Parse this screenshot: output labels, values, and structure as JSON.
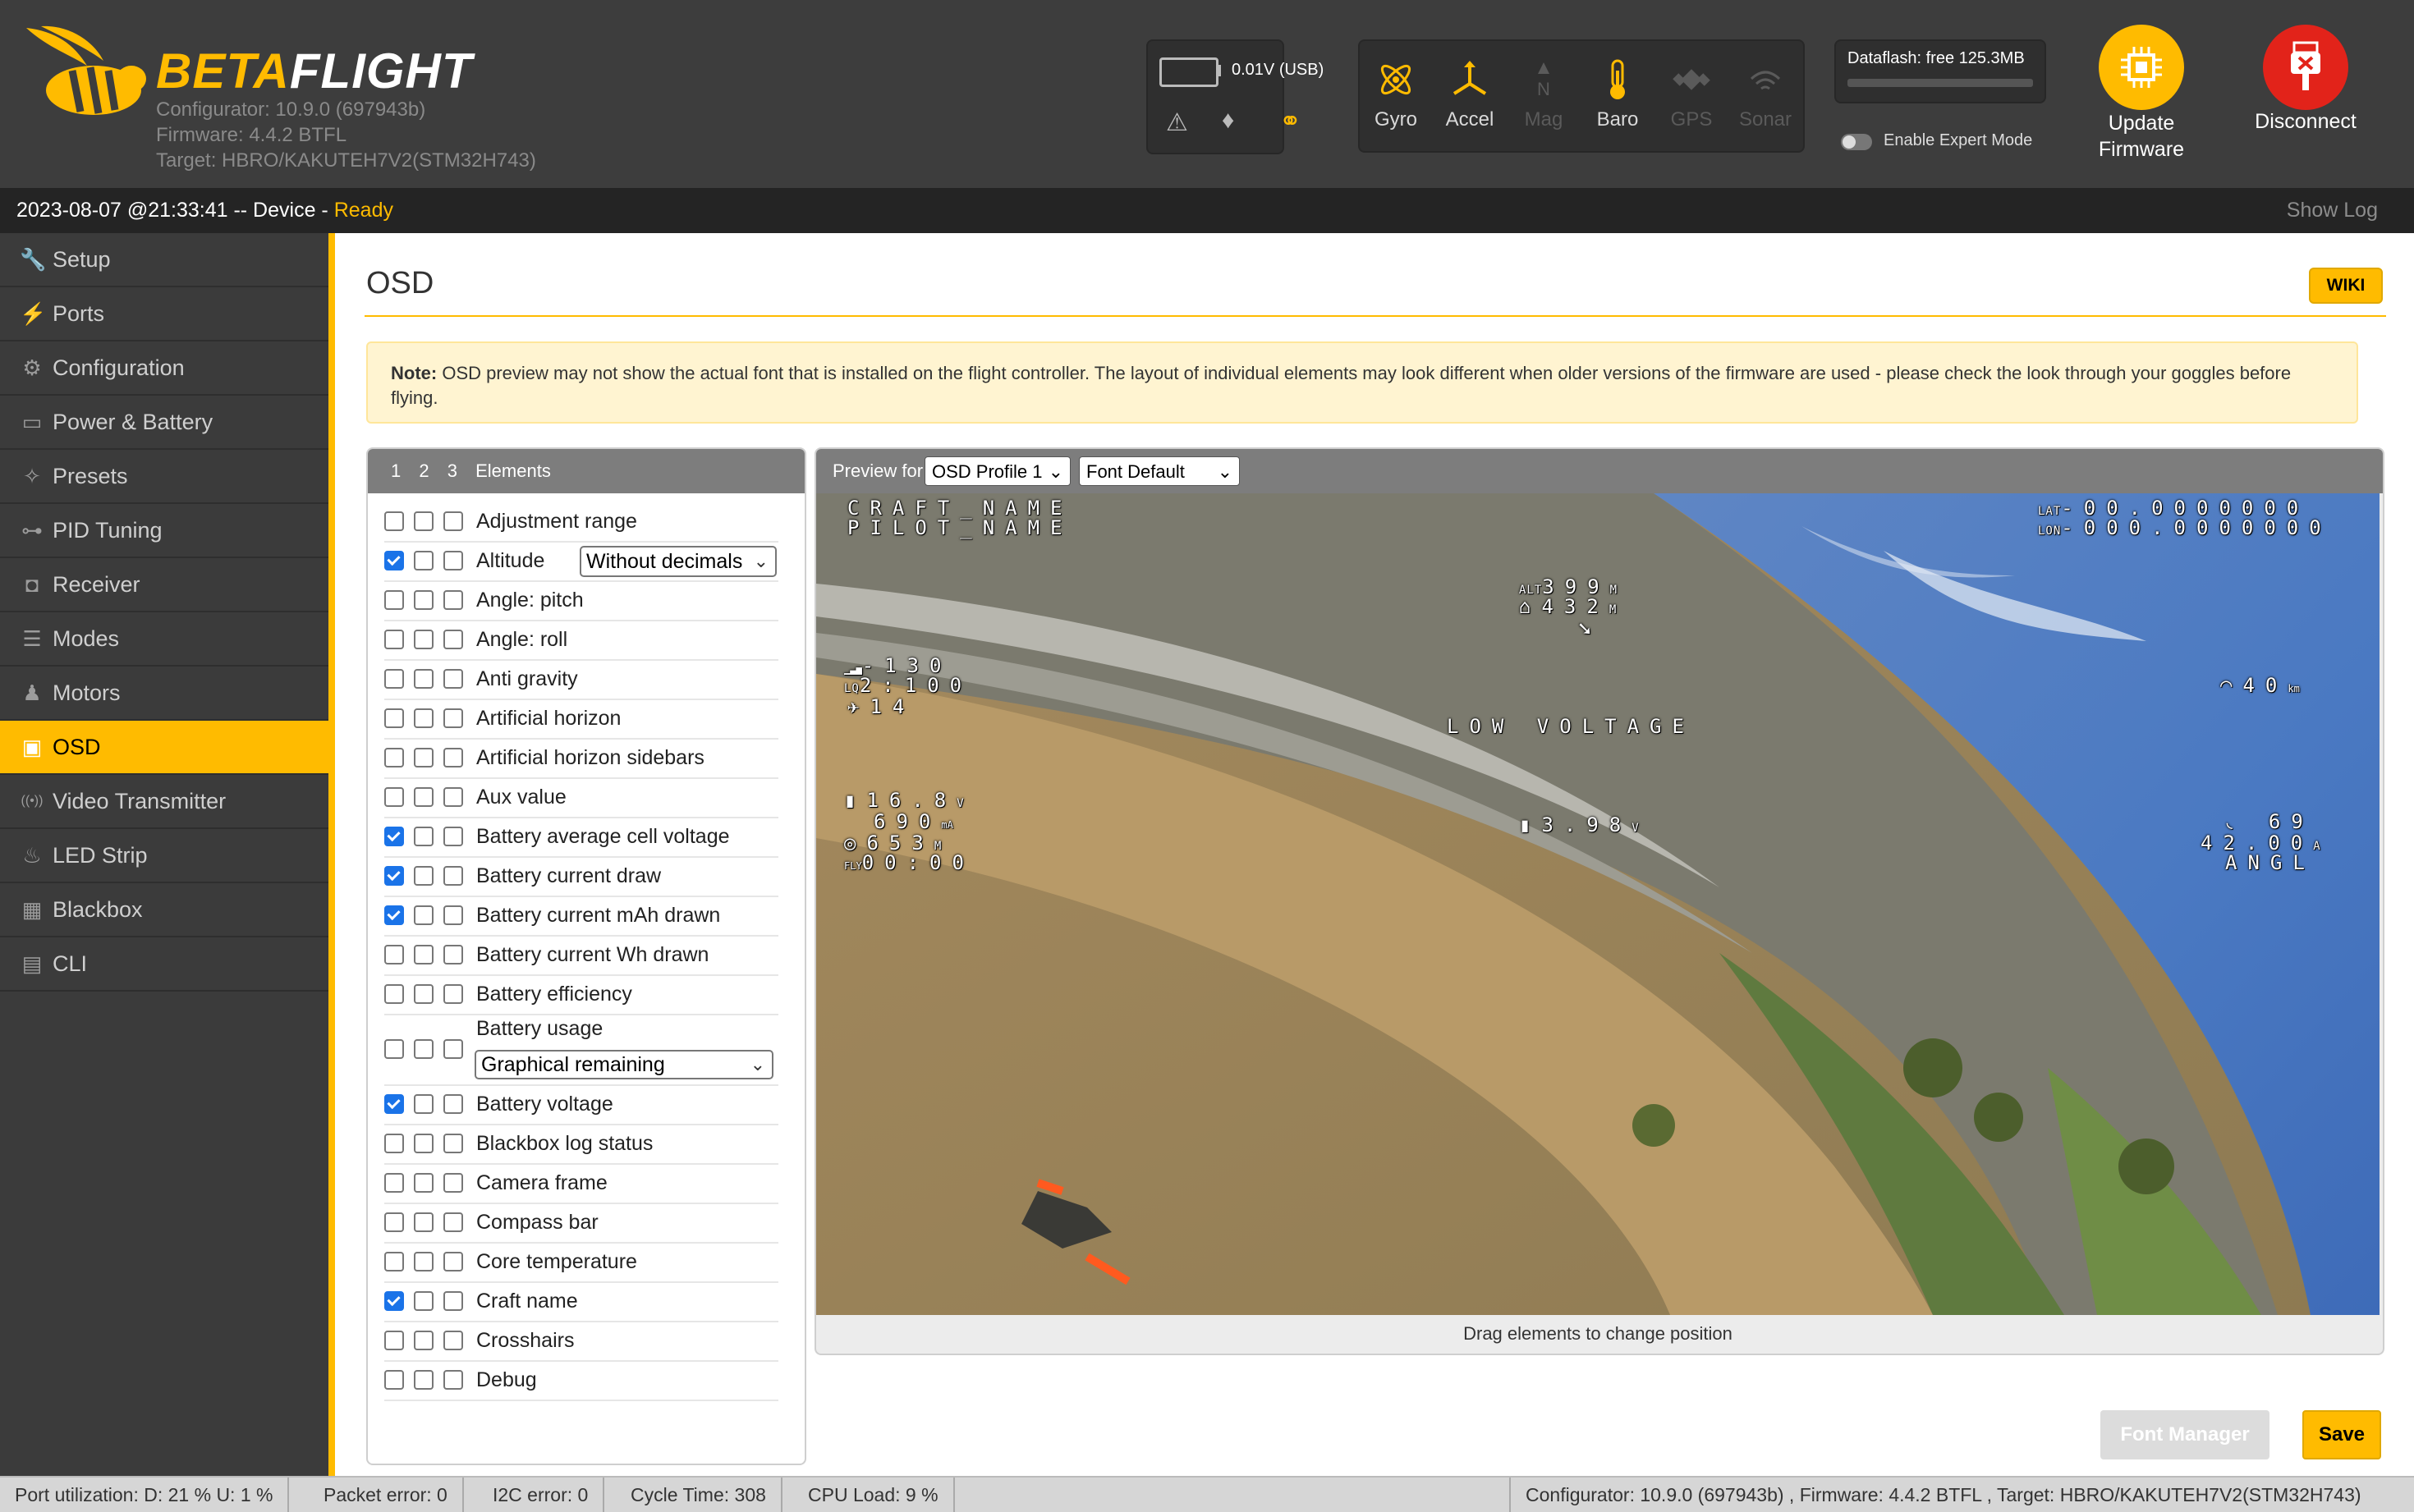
{
  "header": {
    "brand_left": "BETA",
    "brand_right": "FLIGHT",
    "configurator": "Configurator: 10.9.0 (697943b)",
    "firmware": "Firmware: 4.4.2 BTFL",
    "target": "Target: HBRO/KAKUTEH7V2(STM32H743)",
    "battery": "0.01V (USB)",
    "sensors": [
      {
        "label": "Gyro",
        "active": true,
        "icon": "gyro-icon"
      },
      {
        "label": "Accel",
        "active": true,
        "icon": "accel-icon"
      },
      {
        "label": "Mag",
        "active": false,
        "icon": "mag-icon"
      },
      {
        "label": "Baro",
        "active": true,
        "icon": "baro-icon"
      },
      {
        "label": "GPS",
        "active": false,
        "icon": "gps-icon"
      },
      {
        "label": "Sonar",
        "active": false,
        "icon": "sonar-icon"
      }
    ],
    "dataflash": "Dataflash: free 125.3MB",
    "expert_mode": "Enable Expert Mode",
    "update_firmware_1": "Update",
    "update_firmware_2": "Firmware",
    "disconnect": "Disconnect"
  },
  "status": {
    "datetime": "2023-08-07 @21:33:41 -- Device - ",
    "state": "Ready",
    "show_log": "Show Log"
  },
  "sidebar": {
    "items": [
      {
        "label": "Setup",
        "icon": "wrench-icon",
        "glyph": "🔧",
        "active": false
      },
      {
        "label": "Ports",
        "icon": "plug-icon",
        "glyph": "⚡",
        "active": false
      },
      {
        "label": "Configuration",
        "icon": "gear-icon",
        "glyph": "⚙",
        "active": false
      },
      {
        "label": "Power & Battery",
        "icon": "battery-icon",
        "glyph": "▭",
        "active": false
      },
      {
        "label": "Presets",
        "icon": "wand-icon",
        "glyph": "✧",
        "active": false
      },
      {
        "label": "PID Tuning",
        "icon": "sitemap-icon",
        "glyph": "⊶",
        "active": false
      },
      {
        "label": "Receiver",
        "icon": "robot-icon",
        "glyph": "◘",
        "active": false
      },
      {
        "label": "Modes",
        "icon": "toggle-icon",
        "glyph": "☰",
        "active": false
      },
      {
        "label": "Motors",
        "icon": "motor-icon",
        "glyph": "♟",
        "active": false
      },
      {
        "label": "OSD",
        "icon": "osd-icon",
        "glyph": "▣",
        "active": true
      },
      {
        "label": "Video Transmitter",
        "icon": "broadcast-icon",
        "glyph": "((•))",
        "active": false
      },
      {
        "label": "LED Strip",
        "icon": "led-icon",
        "glyph": "♨",
        "active": false
      },
      {
        "label": "Blackbox",
        "icon": "chip-icon",
        "glyph": "▦",
        "active": false
      },
      {
        "label": "CLI",
        "icon": "terminal-icon",
        "glyph": "▤",
        "active": false
      }
    ]
  },
  "main": {
    "title": "OSD",
    "wiki": "WIKI",
    "note_bold": "Note:",
    "note_text": " OSD preview may not show the actual font that is installed on the flight controller. The layout of individual elements may look different when older versions of the firmware are used - please check the look through your goggles before flying.",
    "elements_tabs": [
      "1",
      "2",
      "3"
    ],
    "elements_title": "Elements",
    "rows": [
      {
        "label": "Adjustment range",
        "c1": false
      },
      {
        "label": "Altitude",
        "c1": true,
        "select": "Without decimals"
      },
      {
        "label": "Angle: pitch",
        "c1": false
      },
      {
        "label": "Angle: roll",
        "c1": false
      },
      {
        "label": "Anti gravity",
        "c1": false
      },
      {
        "label": "Artificial horizon",
        "c1": false
      },
      {
        "label": "Artificial horizon sidebars",
        "c1": false
      },
      {
        "label": "Aux value",
        "c1": false
      },
      {
        "label": "Battery average cell voltage",
        "c1": true
      },
      {
        "label": "Battery current draw",
        "c1": true
      },
      {
        "label": "Battery current mAh drawn",
        "c1": true
      },
      {
        "label": "Battery current Wh drawn",
        "c1": false
      },
      {
        "label": "Battery efficiency",
        "c1": false
      },
      {
        "label": "Battery usage",
        "c1": false,
        "select": "Graphical remaining"
      },
      {
        "label": "Battery voltage",
        "c1": true
      },
      {
        "label": "Blackbox log status",
        "c1": false
      },
      {
        "label": "Camera frame",
        "c1": false
      },
      {
        "label": "Compass bar",
        "c1": false
      },
      {
        "label": "Core temperature",
        "c1": false
      },
      {
        "label": "Craft name",
        "c1": true
      },
      {
        "label": "Crosshairs",
        "c1": false
      },
      {
        "label": "Debug",
        "c1": false
      }
    ],
    "preview_for": "Preview for",
    "osd_profile": "OSD Profile 1",
    "font": "Font Default",
    "drag_hint": "Drag elements to change position",
    "font_manager": "Font Manager",
    "save": "Save"
  },
  "osd": {
    "craft": "CRAFT_NAME",
    "pilot": "PILOT_NAME",
    "lat_label": "LAT",
    "lat": "00.0000000",
    "lon_label": "LON",
    "lon": "000.0000000",
    "alt_label": "ALT",
    "alt": "399",
    "alt_unit": "M",
    "home": "432",
    "home_unit": "M",
    "rssi": "-130",
    "lq": "2:100",
    "sats": "14",
    "speed": "40",
    "warning": "LOW VOLTAGE",
    "bat_volt": "16.8",
    "mah": "690",
    "dist": "653",
    "timer": "00:00",
    "cell": "3.98",
    "throttle": "69",
    "current": "42.00",
    "mode": "ANGL"
  },
  "footer": {
    "port_util": "Port utilization: D: 21 % U: 1 %",
    "packet_error": "Packet error: 0",
    "i2c_error": "I2C error: 0",
    "cycle_time": "Cycle Time: 308",
    "cpu_load": "CPU Load: 9 %",
    "version": "Configurator: 10.9.0 (697943b) , Firmware: 4.4.2 BTFL , Target: HBRO/KAKUTEH7V2(STM32H743)"
  },
  "colors": {
    "accent": "#ffbb00",
    "danger": "#e2231a",
    "checkbox": "#1a73e8"
  }
}
